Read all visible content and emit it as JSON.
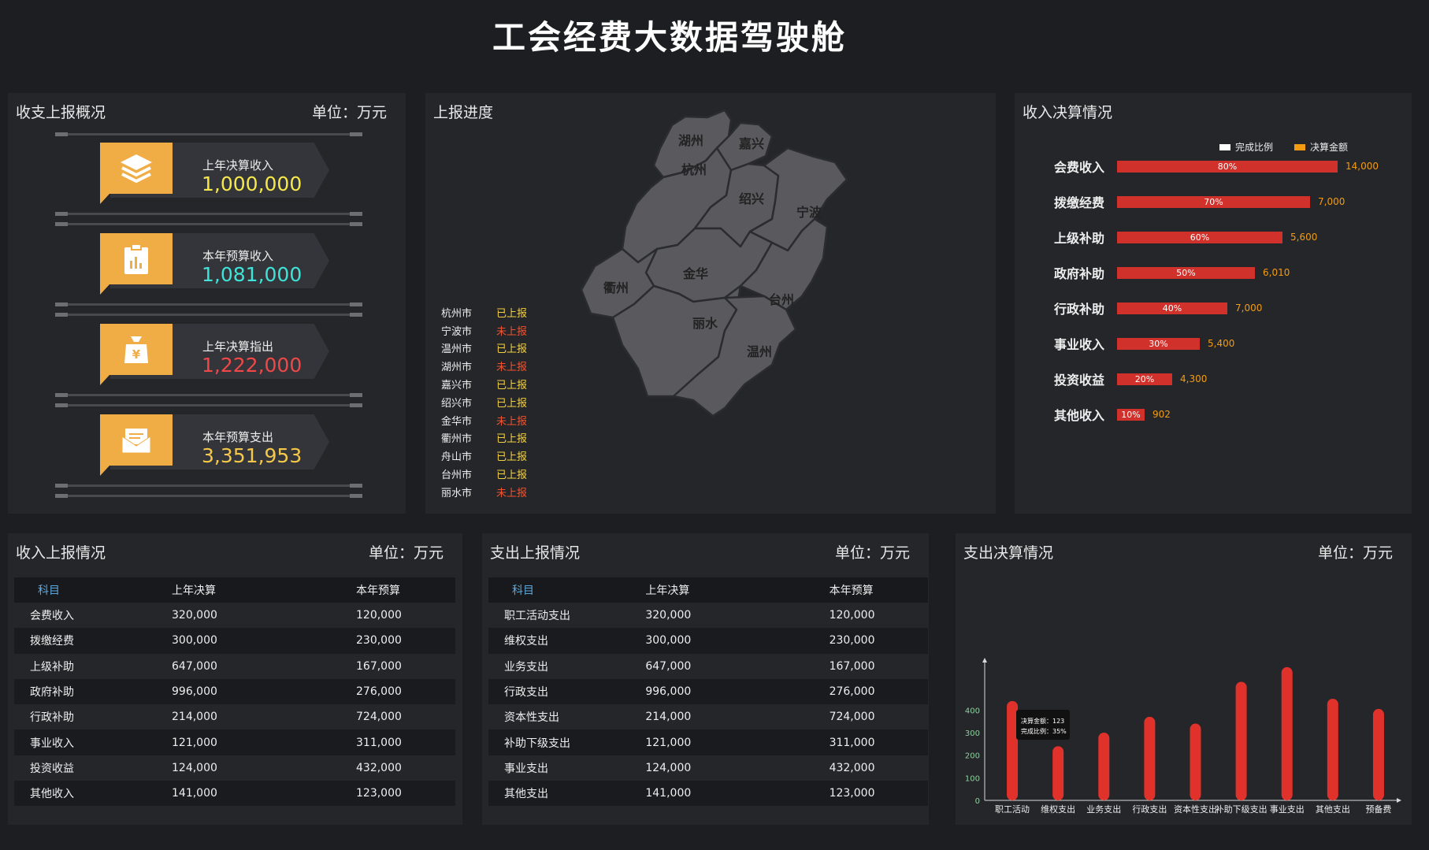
{
  "page_title": "工会经费大数据驾驶舱",
  "overview": {
    "title": "收支上报概况",
    "unit": "单位：万元",
    "items": [
      {
        "label": "上年决算收入",
        "value": "1,000,000",
        "color": "#f7e84a",
        "icon": "layers-icon"
      },
      {
        "label": "本年预算收入",
        "value": "1,081,000",
        "color": "#3fe3d8",
        "icon": "clipboard-chart-icon"
      },
      {
        "label": "上年决算指出",
        "value": "1,222,000",
        "color": "#ef4848",
        "icon": "yen-bag-icon"
      },
      {
        "label": "本年预算支出",
        "value": "3,351,953",
        "color": "#f4c94a",
        "icon": "mail-icon"
      }
    ]
  },
  "progress": {
    "title": "上报进度",
    "status_list": [
      {
        "city": "杭州市",
        "status": "已上报",
        "color": "#f4d03f"
      },
      {
        "city": "宁波市",
        "status": "未上报",
        "color": "#f0532f"
      },
      {
        "city": "温州市",
        "status": "已上报",
        "color": "#f4d03f"
      },
      {
        "city": "湖州市",
        "status": "未上报",
        "color": "#f0532f"
      },
      {
        "city": "嘉兴市",
        "status": "已上报",
        "color": "#f4d03f"
      },
      {
        "city": "绍兴市",
        "status": "已上报",
        "color": "#f4d03f"
      },
      {
        "city": "金华市",
        "status": "未上报",
        "color": "#f0532f"
      },
      {
        "city": "衢州市",
        "status": "已上报",
        "color": "#f4d03f"
      },
      {
        "city": "舟山市",
        "status": "已上报",
        "color": "#f4d03f"
      },
      {
        "city": "台州市",
        "status": "已上报",
        "color": "#f4d03f"
      },
      {
        "city": "丽水市",
        "status": "未上报",
        "color": "#f0532f"
      }
    ],
    "map_labels": [
      "湖州",
      "嘉兴",
      "杭州",
      "绍兴",
      "宁波",
      "金华",
      "衢州",
      "台州",
      "丽水",
      "温州"
    ]
  },
  "income_settlement": {
    "title": "收入决算情况",
    "legend": [
      {
        "name": "完成比例",
        "color": "#ffffff"
      },
      {
        "name": "决算金额",
        "color": "#f39c12"
      }
    ],
    "rows": [
      {
        "label": "会费收入",
        "pct": 80,
        "pct_label": "80%",
        "amount": "14,000"
      },
      {
        "label": "拨缴经费",
        "pct": 70,
        "pct_label": "70%",
        "amount": "7,000"
      },
      {
        "label": "上级补助",
        "pct": 60,
        "pct_label": "60%",
        "amount": "5,600"
      },
      {
        "label": "政府补助",
        "pct": 50,
        "pct_label": "50%",
        "amount": "6,010"
      },
      {
        "label": "行政补助",
        "pct": 40,
        "pct_label": "40%",
        "amount": "7,000"
      },
      {
        "label": "事业收入",
        "pct": 30,
        "pct_label": "30%",
        "amount": "5,400"
      },
      {
        "label": "投资收益",
        "pct": 20,
        "pct_label": "20%",
        "amount": "4,300"
      },
      {
        "label": "其他收入",
        "pct": 10,
        "pct_label": "10%",
        "amount": "902"
      }
    ]
  },
  "income_report": {
    "title": "收入上报情况",
    "unit": "单位：万元",
    "headers": [
      "科目",
      "上年决算",
      "本年预算"
    ],
    "rows": [
      [
        "会费收入",
        "320,000",
        "120,000"
      ],
      [
        "拨缴经费",
        "300,000",
        "230,000"
      ],
      [
        "上级补助",
        "647,000",
        "167,000"
      ],
      [
        "政府补助",
        "996,000",
        "276,000"
      ],
      [
        "行政补助",
        "214,000",
        "724,000"
      ],
      [
        "事业收入",
        "121,000",
        "311,000"
      ],
      [
        "投资收益",
        "124,000",
        "432,000"
      ],
      [
        "其他收入",
        "141,000",
        "123,000"
      ]
    ]
  },
  "expense_report": {
    "title": "支出上报情况",
    "unit": "单位：万元",
    "headers": [
      "科目",
      "上年决算",
      "本年预算"
    ],
    "rows": [
      [
        "职工活动支出",
        "320,000",
        "120,000"
      ],
      [
        "维权支出",
        "300,000",
        "230,000"
      ],
      [
        "业务支出",
        "647,000",
        "167,000"
      ],
      [
        "行政支出",
        "996,000",
        "276,000"
      ],
      [
        "资本性支出",
        "214,000",
        "724,000"
      ],
      [
        "补助下级支出",
        "121,000",
        "311,000"
      ],
      [
        "事业支出",
        "124,000",
        "432,000"
      ],
      [
        "其他支出",
        "141,000",
        "123,000"
      ]
    ]
  },
  "expense_settlement": {
    "title": "支出决算情况",
    "unit": "单位：万元",
    "tooltip": {
      "line1": "决算金额：123",
      "line2": "完成比例：35%"
    },
    "chart_data": {
      "type": "bar",
      "categories": [
        "职工活动",
        "维权支出",
        "业务支出",
        "行政支出",
        "资本性支出",
        "补助下级支出",
        "事业支出",
        "其他支出",
        "预备费"
      ],
      "values": [
        440,
        240,
        300,
        370,
        340,
        525,
        590,
        450,
        405
      ],
      "ylim": [
        0,
        600
      ],
      "yticks": [
        "0",
        "100",
        "200",
        "300",
        "400"
      ],
      "color": "#e0312b"
    }
  }
}
